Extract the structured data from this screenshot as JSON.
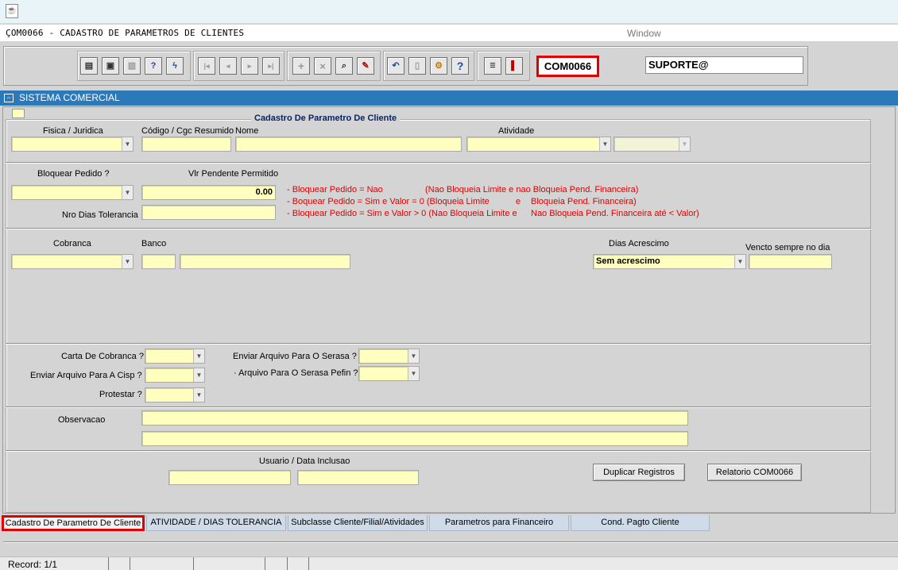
{
  "window": {
    "app_icon": "java-cup-icon",
    "form_title": "ÇOM0066 - CADASTRO DE PARAMETROS DE CLIENTES",
    "menu_window": "Window"
  },
  "toolbar": {
    "icons": [
      "save-icon",
      "print-preview-icon",
      "print-icon",
      "help-query-icon",
      "execute-query-icon",
      "first-record-icon",
      "previous-record-icon",
      "next-record-icon",
      "last-record-icon",
      "insert-record-icon",
      "delete-record-icon",
      "search-icon",
      "clear-icon",
      "undo-icon",
      "paste-icon",
      "tools-icon",
      "help-icon",
      "menu-icon",
      "exit-icon"
    ],
    "form_code": "COM0066",
    "user": "SUPORTE@"
  },
  "system_bar": {
    "label": "SISTEMA COMERCIAL"
  },
  "section": {
    "title": "Cadastro De Parametro De Cliente"
  },
  "row1": {
    "fisica_juridica_label": "Fisica / Juridica",
    "fisica_juridica_value": "",
    "codigo_label": "Código / Cgc Resumido",
    "codigo_value": "",
    "nome_label": "Nome",
    "nome_value": "",
    "atividade_label": "Atividade",
    "atividade_value": "",
    "atividade2_value": ""
  },
  "bloqueio": {
    "bloquear_label": "Bloquear Pedido ?",
    "bloquear_value": "",
    "vlr_label": "Vlr Pendente Permitido",
    "vlr_value": "0.00",
    "nro_dias_label": "Nro Dias Tolerancia",
    "nro_dias_value": "",
    "rules": [
      {
        "left": "- Bloquear Pedido = Nao",
        "mid": "(Nao Bloqueia Limite  e nao Bloqueia Pend. Financeira)"
      },
      {
        "left": "- Boquear Pedido  = Sim e Valor = 0 (Bloqueia Limite",
        "mid": "e",
        "right": "Bloqueia Pend. Financeira)"
      },
      {
        "left": "- Bloquear Pedido = Sim e Valor > 0 (Nao Bloqueia Limite  e",
        "mid": "Nao Bloqueia Pend. Financeira até < Valor)"
      }
    ]
  },
  "cobranca": {
    "cobranca_label": "Cobranca",
    "cobranca_value": "",
    "banco_label": "Banco",
    "banco_code": "",
    "banco_name": "",
    "dias_acrescimo_label": "Dias Acrescimo",
    "dias_acrescimo_value": "Sem acrescimo",
    "vencto_label": "Vencto sempre no dia",
    "vencto_value": ""
  },
  "flags": {
    "carta_label": "Carta De Cobranca ?",
    "carta_value": "",
    "cisp_label": "Enviar Arquivo Para A Cisp ?",
    "cisp_value": "",
    "protestar_label": "Protestar ?",
    "protestar_value": "",
    "serasa_label": "Enviar Arquivo Para O Serasa ?",
    "serasa_value": "",
    "pefin_label": "· Arquivo Para O Serasa Pefin ?",
    "pefin_value": ""
  },
  "observacao": {
    "label": "Observacao",
    "line1": "",
    "line2": ""
  },
  "usuario": {
    "label": "Usuario / Data Inclusao",
    "user_value": "",
    "date_value": "",
    "duplicar_button": "Duplicar Registros",
    "relatorio_button": "Relatorio COM0066"
  },
  "tabs": [
    {
      "label": "Cadastro De Parametro De Cliente",
      "active": true
    },
    {
      "label": "ATIVIDADE / DIAS TOLERANCIA",
      "active": false
    },
    {
      "label": "Subclasse Cliente/Filial/Atividades",
      "active": false
    },
    {
      "label": "Parametros para Financeiro",
      "active": false
    },
    {
      "label": "Cond. Pagto Cliente",
      "active": false
    }
  ],
  "status": {
    "record": "Record: 1/1"
  },
  "colors": {
    "field_bg": "#ffffc0",
    "accent_bar": "#2b79b8",
    "highlight": "#e00000",
    "section_title": "#0c2268"
  }
}
